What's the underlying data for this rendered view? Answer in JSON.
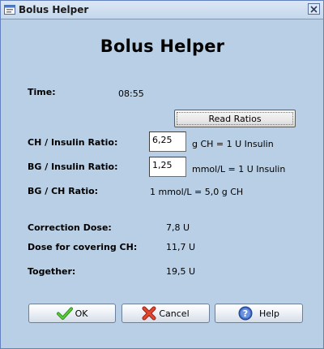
{
  "window": {
    "title": "Bolus Helper"
  },
  "heading": "Bolus Helper",
  "time": {
    "label": "Time:",
    "value": "08:55"
  },
  "read_ratios_label": "Read Ratios",
  "ch_insulin": {
    "label": "CH / Insulin Ratio:",
    "value": "6,25",
    "unit": "g CH  =  1 U Insulin"
  },
  "bg_insulin": {
    "label": "BG / Insulin Ratio:",
    "value": "1,25",
    "unit": "mmol/L  =  1 U Insulin"
  },
  "bg_ch": {
    "label": "BG / CH Ratio:",
    "value": "1 mmol/L  =  5,0 g CH"
  },
  "correction": {
    "label": "Correction Dose:",
    "value": "7,8  U"
  },
  "covering": {
    "label": "Dose for covering CH:",
    "value": "11,7  U"
  },
  "together": {
    "label": "Together:",
    "value": "19,5  U"
  },
  "buttons": {
    "ok": "OK",
    "cancel": "Cancel",
    "help": "Help"
  },
  "icons": {
    "title": "app-icon",
    "close": "close-icon",
    "ok": "checkmark-icon",
    "cancel": "x-icon",
    "help": "question-icon"
  },
  "colors": {
    "background": "#b8cfe5",
    "ok_green": "#3aa428",
    "cancel_red": "#d43a2a",
    "help_blue": "#3c68c4"
  }
}
